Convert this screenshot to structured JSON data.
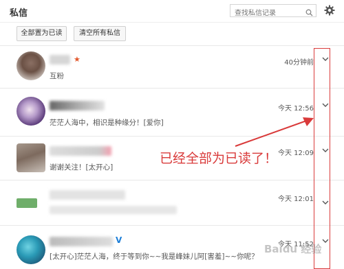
{
  "header": {
    "title": "私信",
    "search_placeholder": "查找私信记录",
    "search_icon": "search-icon",
    "settings_icon": "gear-icon"
  },
  "toolbar": {
    "mark_all_read_label": "全部置为已读",
    "clear_all_label": "清空所有私信"
  },
  "messages": [
    {
      "preview": "互粉",
      "time": "40分钟前",
      "badge": "star"
    },
    {
      "preview": "茫茫人海中，相识是种缘分！[爱你]",
      "time": "今天 12:56",
      "badge": ""
    },
    {
      "preview": "谢谢关注！[太开心]",
      "time": "今天 12:09",
      "badge": ""
    },
    {
      "preview": "",
      "time": "今天 12:01",
      "badge": ""
    },
    {
      "preview": "[太开心]茫茫人海，终于等到你~~我是峰妹儿阿[害羞]~~你呢？",
      "time": "今天 11:52",
      "badge": "v"
    }
  ],
  "annotation": {
    "text": "已经全部为已读了！",
    "color": "#d93a3a"
  },
  "watermark": "Baidu 经验"
}
